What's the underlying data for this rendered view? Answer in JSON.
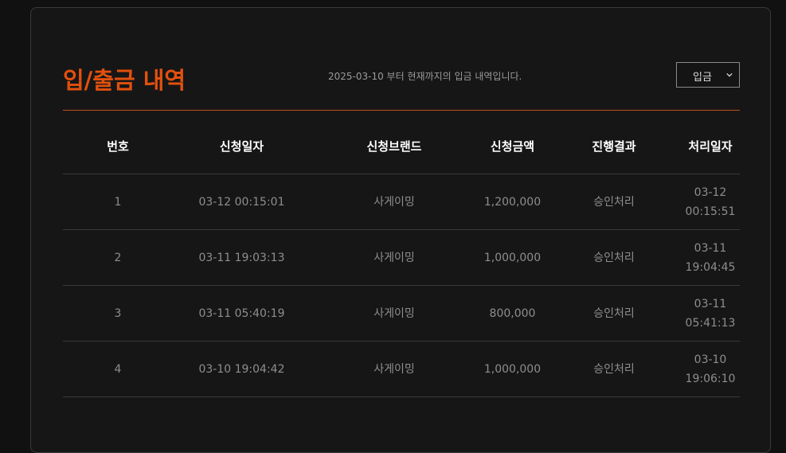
{
  "title": "입/출금 내역",
  "subtitle": "2025-03-10 부터 현재까지의 입금 내역입니다.",
  "filter": {
    "selected": "입금"
  },
  "table": {
    "headers": [
      "번호",
      "신청일자",
      "신청브랜드",
      "신청금액",
      "진행결과",
      "처리일자"
    ],
    "rows": [
      {
        "no": "1",
        "request_date": "03-12 00:15:01",
        "brand": "사게이밍",
        "amount": "1,200,000",
        "result": "승인처리",
        "proc_date": "03-12",
        "proc_time": "00:15:51"
      },
      {
        "no": "2",
        "request_date": "03-11 19:03:13",
        "brand": "사게이밍",
        "amount": "1,000,000",
        "result": "승인처리",
        "proc_date": "03-11",
        "proc_time": "19:04:45"
      },
      {
        "no": "3",
        "request_date": "03-11 05:40:19",
        "brand": "사게이밍",
        "amount": "800,000",
        "result": "승인처리",
        "proc_date": "03-11",
        "proc_time": "05:41:13"
      },
      {
        "no": "4",
        "request_date": "03-10 19:04:42",
        "brand": "사게이밍",
        "amount": "1,000,000",
        "result": "승인처리",
        "proc_date": "03-10",
        "proc_time": "19:06:10"
      }
    ]
  },
  "colors": {
    "accent": "#e2500e",
    "background": "#161616"
  }
}
